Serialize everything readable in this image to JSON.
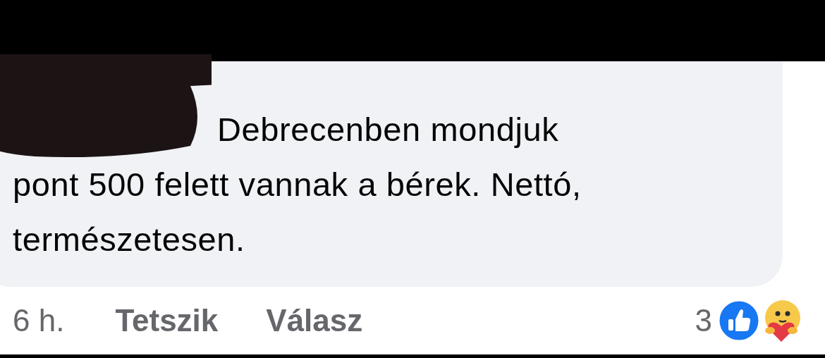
{
  "comment": {
    "author_redacted": true,
    "text_lines": [
      "Debrecenben mondjuk",
      "pont 500 felett vannak a bérek. Nettó,",
      "természetesen."
    ]
  },
  "actions": {
    "time": "6 h.",
    "like": "Tetszik",
    "reply": "Válasz"
  },
  "reactions": {
    "count": "3",
    "types": [
      {
        "kind": "like"
      },
      {
        "kind": "care"
      }
    ]
  }
}
